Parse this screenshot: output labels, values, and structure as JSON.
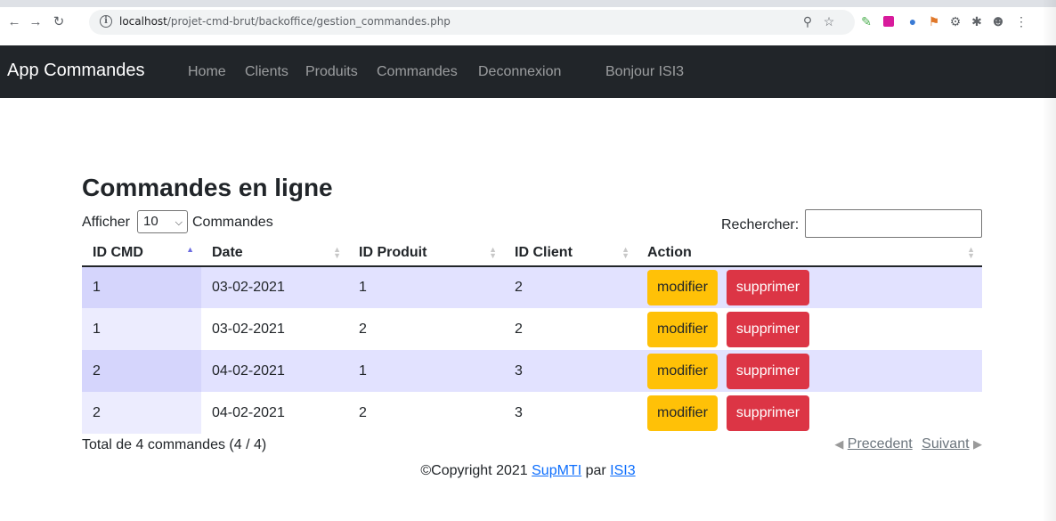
{
  "browser": {
    "url_host": "localhost",
    "url_path": "/projet-cmd-brut/backoffice/gestion_commandes.php"
  },
  "navbar": {
    "brand": "App Commandes",
    "links": [
      "Home",
      "Clients",
      "Produits",
      "Commandes",
      "Deconnexion"
    ],
    "greeting": "Bonjour ISI3"
  },
  "main": {
    "title": "Commandes en ligne",
    "show_label": "Afficher",
    "page_length": "10",
    "show_unit": "Commandes",
    "search_label": "Rechercher:",
    "search_value": ""
  },
  "table": {
    "headers": [
      "ID CMD",
      "Date",
      "ID Produit",
      "ID Client",
      "Action"
    ],
    "rows": [
      [
        "1",
        "03-02-2021",
        "1",
        "2"
      ],
      [
        "1",
        "03-02-2021",
        "2",
        "2"
      ],
      [
        "2",
        "04-02-2021",
        "1",
        "3"
      ],
      [
        "2",
        "04-02-2021",
        "2",
        "3"
      ]
    ],
    "edit_label": "modifier",
    "delete_label": "supprimer"
  },
  "info": "Total de 4 commandes (4 / 4)",
  "pager": {
    "prev": "Precedent",
    "next": "Suivant"
  },
  "footer": {
    "prefix": "©Copyright 2021",
    "link1": "SupMTI",
    "middle": "par",
    "link2": "ISI3"
  },
  "colors": {
    "navbar_bg": "#212529",
    "btn_warning": "#ffc107",
    "btn_danger": "#dc3545",
    "row_odd": "#e2e2ff",
    "link": "#0d6efd"
  }
}
